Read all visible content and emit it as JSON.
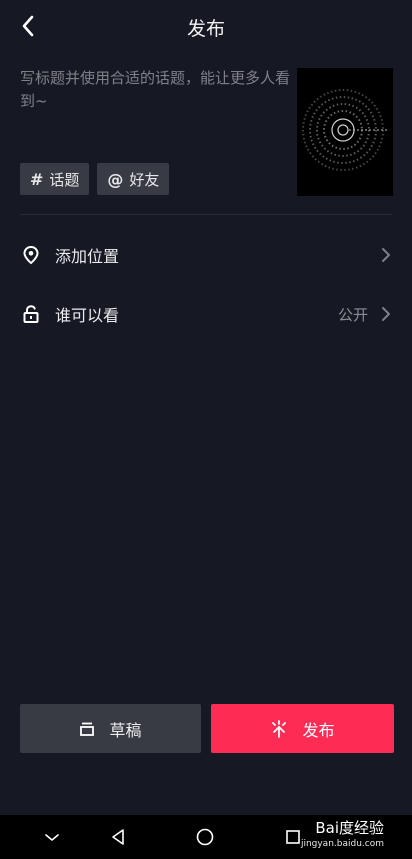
{
  "header": {
    "title": "发布",
    "back_icon": "chevron-left-icon"
  },
  "caption": {
    "placeholder": "写标题并使用合适的话题，能让更多人看到~"
  },
  "chips": [
    {
      "symbol": "#",
      "label": "话题",
      "icon": "hashtag-icon"
    },
    {
      "symbol": "@",
      "label": "好友",
      "icon": "at-icon"
    }
  ],
  "options": {
    "location": {
      "label": "添加位置",
      "icon": "location-pin-icon"
    },
    "visibility": {
      "label": "谁可以看",
      "value": "公开",
      "icon": "unlock-icon"
    }
  },
  "actions": {
    "draft_label": "草稿",
    "publish_label": "发布"
  },
  "colors": {
    "background": "#161823",
    "accent": "#fe2c55",
    "chip_bg": "#393b44"
  },
  "watermark": {
    "brand": "Bai度经验",
    "url": "jingyan.baidu.com"
  }
}
